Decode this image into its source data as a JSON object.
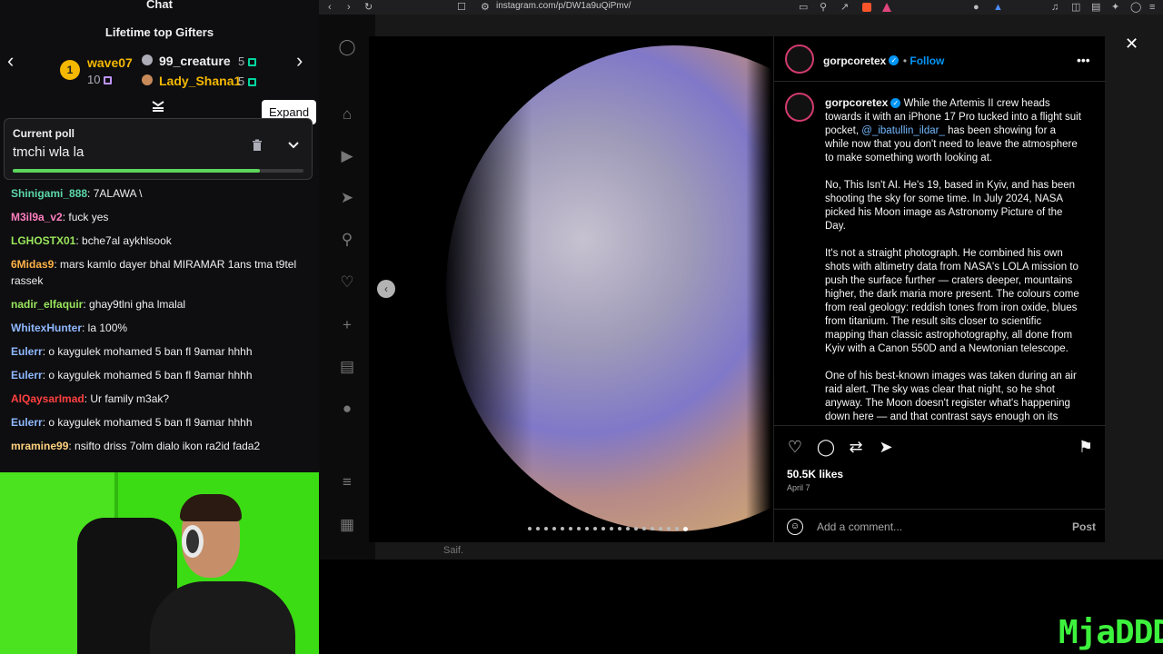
{
  "chat": {
    "title": "Chat",
    "gifters_title": "Lifetime top Gifters",
    "gifters": [
      {
        "rank": "1",
        "name": "wave07",
        "count": "10"
      },
      {
        "name": "99_creature",
        "count": "5"
      },
      {
        "name": "Lady_Shana1",
        "count": "5"
      }
    ],
    "poll": {
      "label": "Current poll",
      "text": "tmchi wla la",
      "progress": 0.85
    },
    "tooltip": "Expand",
    "messages": [
      {
        "user": "Shinigami_888",
        "text": ": 7ALAWA \\",
        "color": "#5cd6a8"
      },
      {
        "user": "M3il9a_v2",
        "text": ": fuck yes",
        "color": "#ff7fbf"
      },
      {
        "user": "LGHOSTX01",
        "text": ": bche7al aykhlsook",
        "color": "#9ae65c"
      },
      {
        "user": "6Midas9",
        "text": ": mars kamlo dayer bhal MIRAMAR 1ans tma t9tel rassek",
        "color": "#ffb347"
      },
      {
        "user": "nadir_elfaquir",
        "text": ": ghay9tlni gha lmalal",
        "color": "#9ae65c"
      },
      {
        "user": "WhitexHunter",
        "text": ": la 100%",
        "color": "#8fb8ff"
      },
      {
        "user": "Eulerr",
        "text": ": o kaygulek mohamed 5 ban fl 9amar hhhh",
        "color": "#8fb8ff"
      },
      {
        "user": "Eulerr",
        "text": ": o kaygulek mohamed 5 ban fl 9amar hhhh",
        "color": "#8fb8ff"
      },
      {
        "user": "AlQaysarImad",
        "text": ": Ur family m3ak?",
        "color": "#ff4040"
      },
      {
        "user": "Eulerr",
        "text": ": o kaygulek mohamed 5 ban fl 9amar hhhh",
        "color": "#8fb8ff"
      },
      {
        "user": "mramine99",
        "text": ": nsifto driss 7olm dialo ikon ra2id fada2",
        "color": "#ffd27f"
      }
    ]
  },
  "browser": {
    "url": "instagram.com/p/DW1a9uQiPmv/"
  },
  "post": {
    "username": "gorpcoretex",
    "follow": "Follow",
    "caption_intro": "While the Artemis II crew heads towards it with an iPhone 17 Pro tucked into a flight suit pocket,",
    "mention": "@_ibatullin_ildar_",
    "caption_intro_end": "has been showing for a while now that you don't need to leave the atmosphere to make something worth looking at.",
    "para2": "No, This Isn't AI. He's 19, based in Kyiv, and has been shooting the sky for some time. In July 2024, NASA picked his Moon image as Astronomy Picture of the Day.",
    "para3": "It's not a straight photograph. He combined his own shots with altimetry data from NASA's LOLA mission to push the surface further — craters deeper, mountains higher, the dark maria more present. The colours come from real geology: reddish tones from iron oxide, blues from titanium. The result sits closer to scientific mapping than classic astrophotography, all done from Kyiv with a Canon 550D and a Newtonian telescope.",
    "para4": "One of his best-known images was taken during an air raid alert. The sky was clear that night, so he shot anyway. The Moon doesn't register what's happening down here — and that contrast says enough on its",
    "likes": "50.5K likes",
    "date": "April 7",
    "comment_placeholder": "Add a comment...",
    "post_label": "Post",
    "behind_name": "Saif."
  },
  "watermark": "MjaDDD"
}
